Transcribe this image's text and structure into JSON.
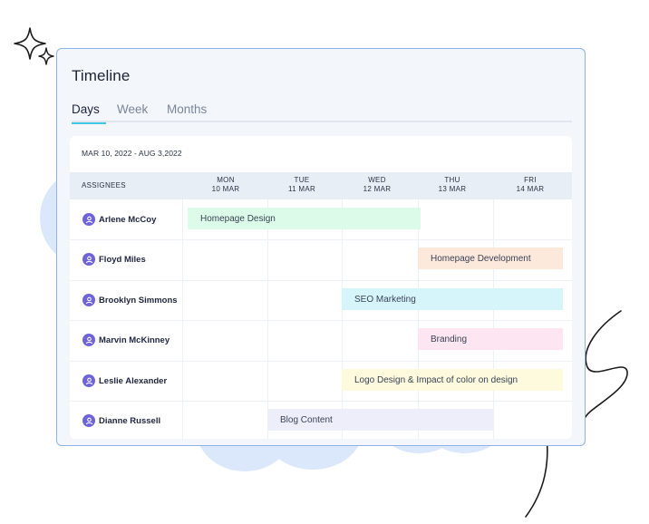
{
  "card": {
    "title": "Timeline"
  },
  "tabs": [
    {
      "label": "Days"
    },
    {
      "label": "Week"
    },
    {
      "label": "Months"
    }
  ],
  "date_range": "MAR 10, 2022 - AUG 3,2022",
  "header": {
    "assignees": "ASSIGNEES",
    "days": [
      {
        "weekday": "MON",
        "date": "10 MAR"
      },
      {
        "weekday": "TUE",
        "date": "11 MAR"
      },
      {
        "weekday": "WED",
        "date": "12 MAR"
      },
      {
        "weekday": "THU",
        "date": "13 MAR"
      },
      {
        "weekday": "FRI",
        "date": "14 MAR"
      }
    ]
  },
  "rows": [
    {
      "name": "Arlene McCoy",
      "task": "Homepage Design",
      "color": "#dcfbe9"
    },
    {
      "name": "Floyd Miles",
      "task": "Homepage Development",
      "color": "#fde8dc"
    },
    {
      "name": "Brooklyn Simmons",
      "task": "SEO Marketing",
      "color": "#d6f5fb"
    },
    {
      "name": "Marvin McKinney",
      "task": "Branding",
      "color": "#fde6f1"
    },
    {
      "name": "Leslie Alexander",
      "task": "Logo Design & Impact of color on design",
      "color": "#fdfadd"
    },
    {
      "name": "Dianne Russell",
      "task": "Blog Content",
      "color": "#eeeefa"
    }
  ],
  "colors": {
    "accent": "#42c6e6",
    "avatar": "#6e63d8",
    "card_border": "#8fb3e8"
  }
}
